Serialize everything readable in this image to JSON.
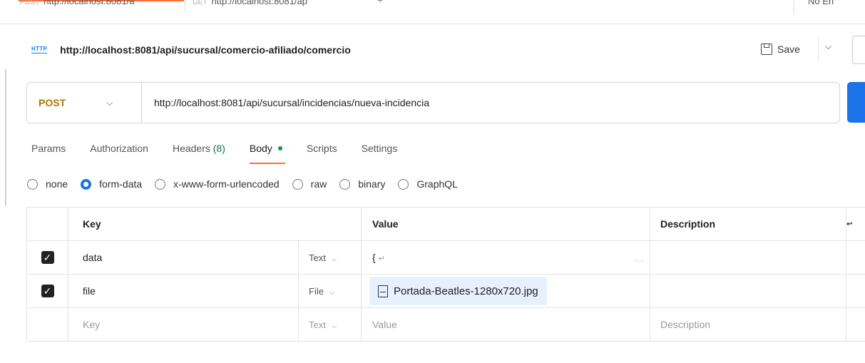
{
  "tabs": {
    "tab1_label": "http://localhost:8081/a",
    "tab1_method": "POST",
    "tab2_label": "http://localhost:8081/ap",
    "tab2_method": "GET",
    "add_icon": "+",
    "right_label": "No En"
  },
  "request": {
    "icon_label": "HTTP",
    "title": "http://localhost:8081/api/sucursal/comercio-afiliado/comercio",
    "save_label": "Save",
    "method": "POST",
    "url": "http://localhost:8081/api/sucursal/incidencias/nueva-incidencia"
  },
  "subtabs": [
    {
      "label": "Params"
    },
    {
      "label": "Authorization"
    },
    {
      "label": "Headers",
      "count": "(8)"
    },
    {
      "label": "Body",
      "active": true
    },
    {
      "label": "Scripts"
    },
    {
      "label": "Settings"
    }
  ],
  "body_types": [
    {
      "label": "none",
      "selected": false
    },
    {
      "label": "form-data",
      "selected": true
    },
    {
      "label": "x-www-form-urlencoded",
      "selected": false
    },
    {
      "label": "raw",
      "selected": false
    },
    {
      "label": "binary",
      "selected": false
    },
    {
      "label": "GraphQL",
      "selected": false
    }
  ],
  "table": {
    "headers": {
      "key": "Key",
      "value": "Value",
      "description": "Description",
      "extra": "↩"
    },
    "rows": [
      {
        "checked": true,
        "key": "data",
        "type": "Text",
        "value": "{",
        "value_icon": "return-icon",
        "description": ""
      },
      {
        "checked": true,
        "key": "file",
        "type": "File",
        "value": "Portada-Beatles-1280x720.jpg",
        "description": ""
      }
    ],
    "placeholder_row": {
      "key": "Key",
      "type": "Text",
      "value": "Value",
      "description": "Description"
    }
  },
  "colors": {
    "accent": "#ff6c37",
    "method_post": "#a97a00",
    "primary_blue": "#1a73e8",
    "status_green": "#0c9a46"
  }
}
